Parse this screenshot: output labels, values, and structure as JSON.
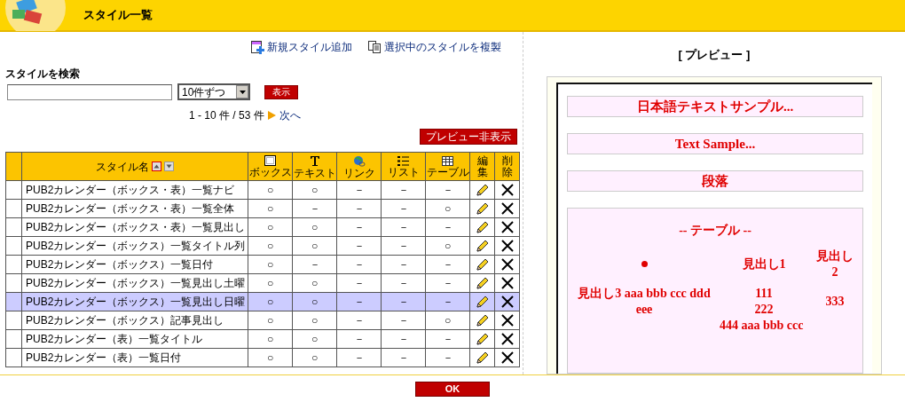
{
  "header": {
    "title": "スタイル一覧"
  },
  "actions": [
    {
      "label": "新規スタイル追加"
    },
    {
      "label": "選択中のスタイルを複製"
    }
  ],
  "search": {
    "label": "スタイルを検索",
    "per_page": "10件ずつ",
    "button": "表示"
  },
  "pagination": {
    "range": "1 - 10 件 / 53 件",
    "next": "次へ"
  },
  "preview_toggle": "プレビュー非表示",
  "table": {
    "name_column": "スタイル名",
    "sort_ascending": true,
    "columns": [
      {
        "label": "ボックス"
      },
      {
        "label": "テキスト"
      },
      {
        "label": "リンク"
      },
      {
        "label": "リスト"
      },
      {
        "label": "テーブル"
      }
    ],
    "edit_column": "編集",
    "delete_column": "削除",
    "rows": [
      {
        "name": "PUB2カレンダー（ボックス・表）一覧ナビ",
        "cells": [
          "○",
          "○",
          "－",
          "－",
          "－"
        ],
        "selected": false
      },
      {
        "name": "PUB2カレンダー（ボックス・表）一覧全体",
        "cells": [
          "○",
          "－",
          "－",
          "－",
          "○"
        ],
        "selected": false
      },
      {
        "name": "PUB2カレンダー（ボックス・表）一覧見出し",
        "cells": [
          "○",
          "○",
          "－",
          "－",
          "－"
        ],
        "selected": false
      },
      {
        "name": "PUB2カレンダー（ボックス）一覧タイトル列",
        "cells": [
          "○",
          "○",
          "－",
          "－",
          "○"
        ],
        "selected": false
      },
      {
        "name": "PUB2カレンダー（ボックス）一覧日付",
        "cells": [
          "○",
          "－",
          "－",
          "－",
          "－"
        ],
        "selected": false
      },
      {
        "name": "PUB2カレンダー（ボックス）一覧見出し土曜",
        "cells": [
          "○",
          "○",
          "－",
          "－",
          "－"
        ],
        "selected": false
      },
      {
        "name": "PUB2カレンダー（ボックス）一覧見出し日曜",
        "cells": [
          "○",
          "○",
          "－",
          "－",
          "－"
        ],
        "selected": true
      },
      {
        "name": "PUB2カレンダー（ボックス）記事見出し",
        "cells": [
          "○",
          "○",
          "－",
          "－",
          "○"
        ],
        "selected": false
      },
      {
        "name": "PUB2カレンダー（表）一覧タイトル",
        "cells": [
          "○",
          "○",
          "－",
          "－",
          "－"
        ],
        "selected": false
      },
      {
        "name": "PUB2カレンダー（表）一覧日付",
        "cells": [
          "○",
          "○",
          "－",
          "－",
          "－"
        ],
        "selected": false
      }
    ]
  },
  "preview": {
    "title": "[ プレビュー ]",
    "samples": [
      "日本語テキストサンプル...",
      "Text Sample...",
      "段落"
    ],
    "table_caption": "-- テーブル --",
    "heading_1": "見出し1",
    "heading_2": "見出し2",
    "heading_3": "見出し3 aaa bbb ccc ddd eee",
    "cell_1": "111",
    "cell_2": "222",
    "cell_3": "333",
    "cell_4": "444 aaa bbb ccc"
  },
  "ok_button": "OK"
}
